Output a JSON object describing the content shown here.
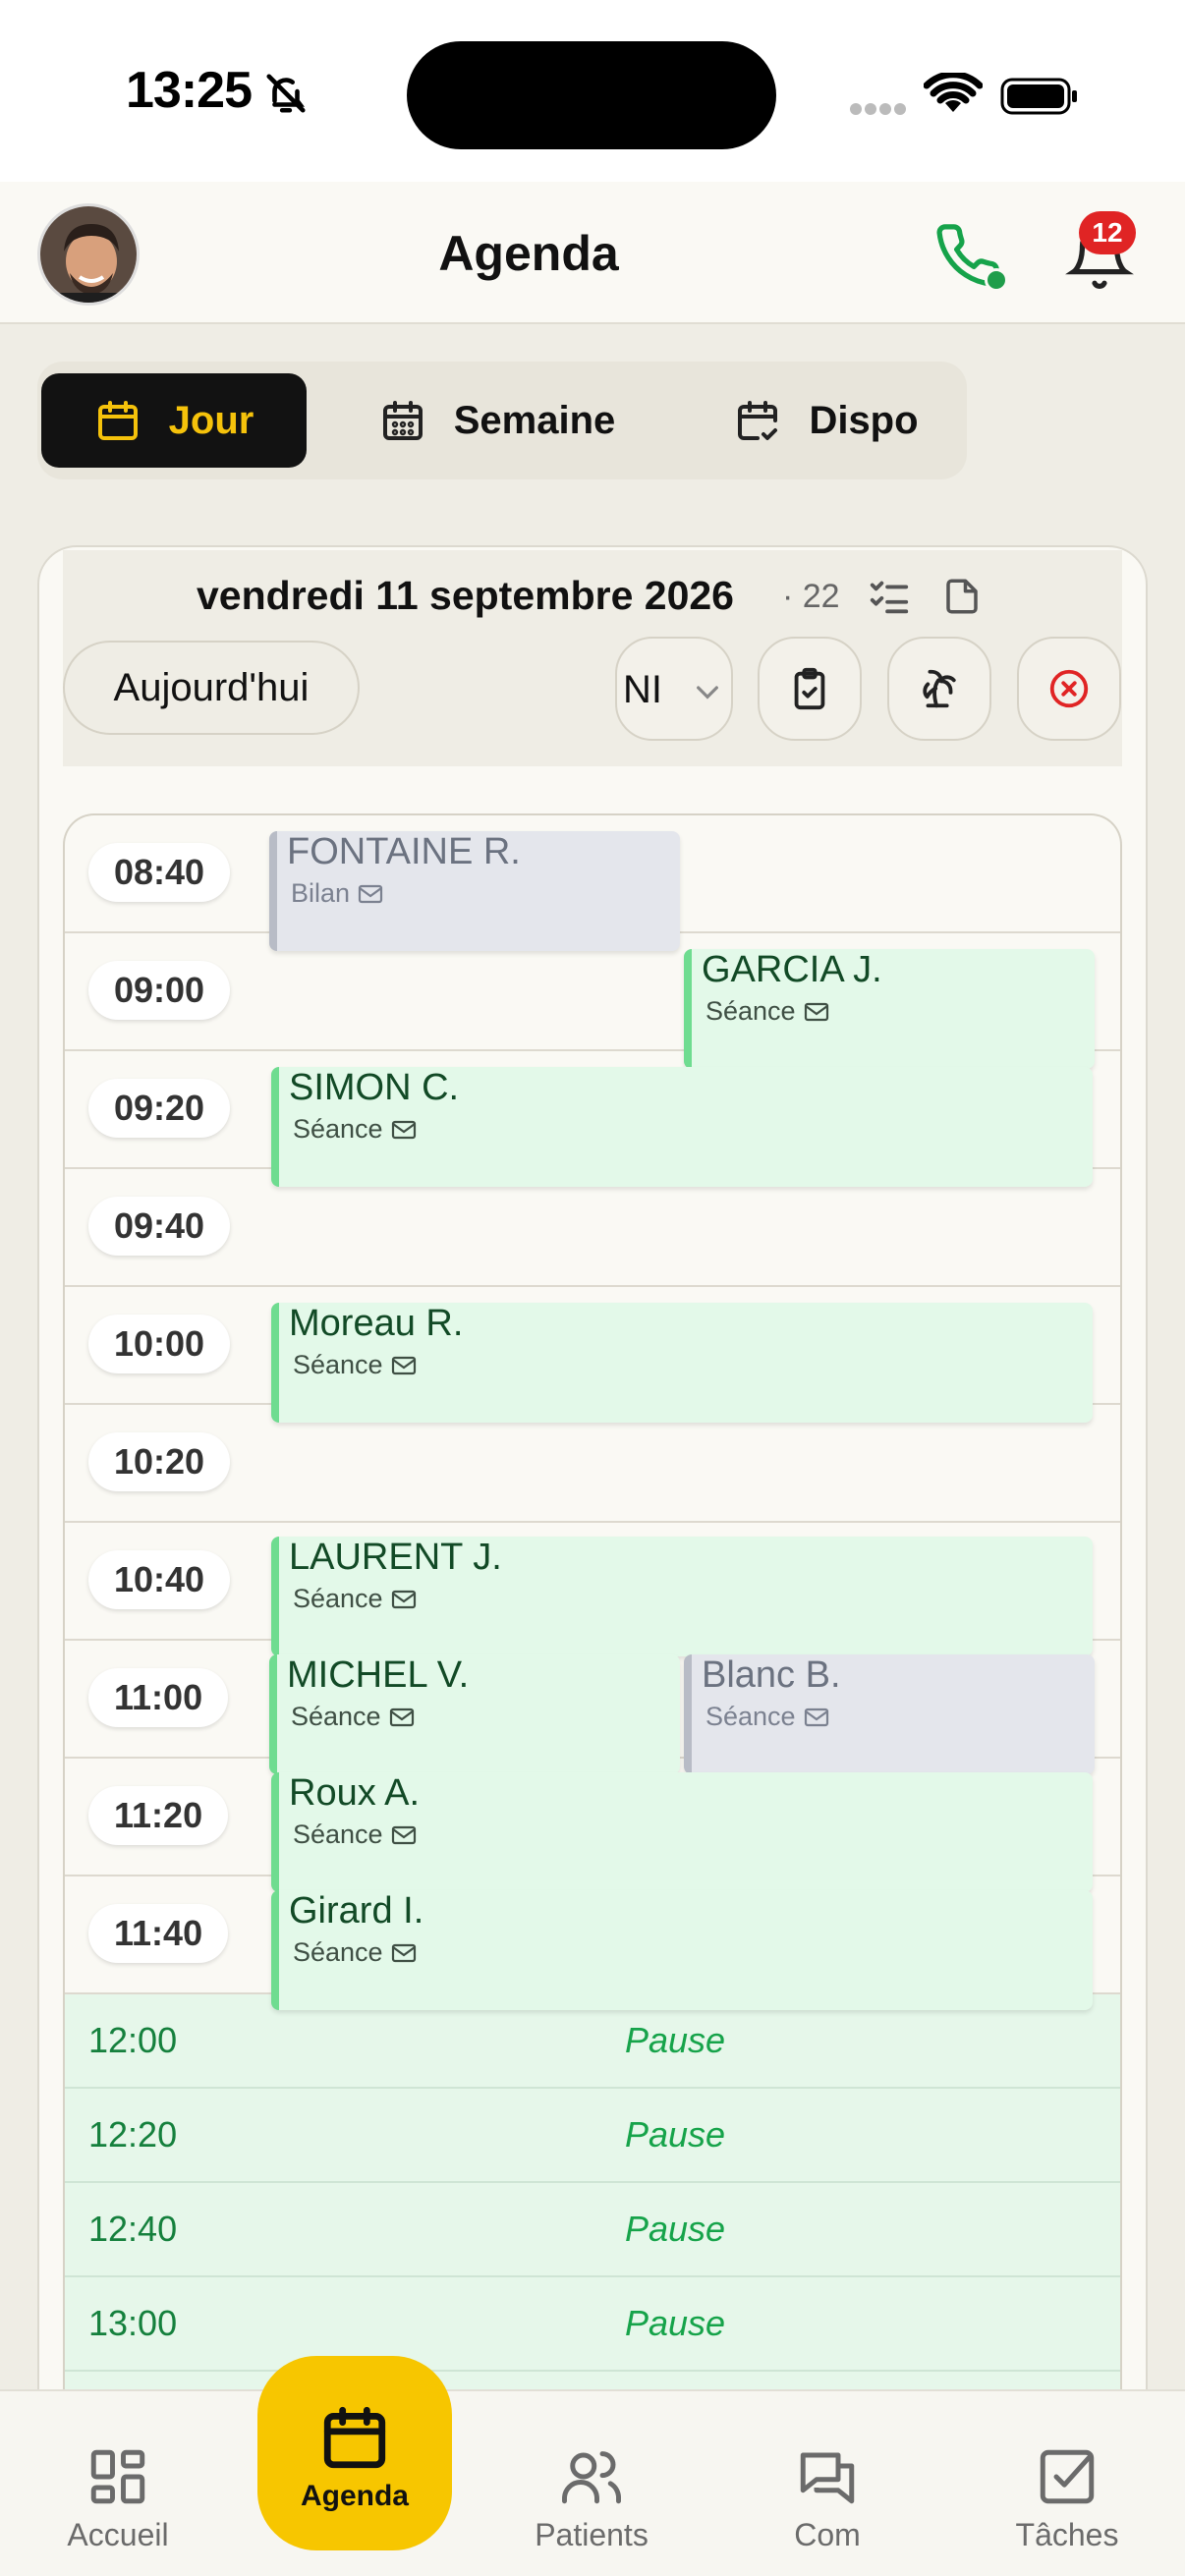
{
  "status_bar": {
    "time": "13:25"
  },
  "header": {
    "title": "Agenda",
    "notification_count": "12"
  },
  "tabs": [
    {
      "label": "Jour",
      "active": true
    },
    {
      "label": "Semaine",
      "active": false
    },
    {
      "label": "Dispo",
      "active": false
    }
  ],
  "date_bar": {
    "date": "vendredi 11 septembre 2026",
    "count": "· 22",
    "today_label": "Aujourd'hui",
    "select_value": "NI"
  },
  "time_slots": [
    "08:40",
    "09:00",
    "09:20",
    "09:40",
    "10:00",
    "10:20",
    "10:40",
    "11:00",
    "11:20",
    "11:40"
  ],
  "appointments": [
    {
      "name": "FONTAINE R.",
      "type": "Bilan",
      "status": "gray"
    },
    {
      "name": "GARCIA J.",
      "type": "Séance",
      "status": "green"
    },
    {
      "name": "SIMON C.",
      "type": "Séance",
      "status": "green"
    },
    {
      "name": "Moreau R.",
      "type": "Séance",
      "status": "green"
    },
    {
      "name": "LAURENT J.",
      "type": "Séance",
      "status": "green"
    },
    {
      "name": "MICHEL V.",
      "type": "Séance",
      "status": "green"
    },
    {
      "name": "Blanc B.",
      "type": "Séance",
      "status": "gray"
    },
    {
      "name": "Roux A.",
      "type": "Séance",
      "status": "green"
    },
    {
      "name": "Girard I.",
      "type": "Séance",
      "status": "green"
    }
  ],
  "pauses": [
    {
      "time": "12:00",
      "label": "Pause"
    },
    {
      "time": "12:20",
      "label": "Pause"
    },
    {
      "time": "12:40",
      "label": "Pause"
    },
    {
      "time": "13:00",
      "label": "Pause"
    }
  ],
  "bottom_nav": [
    {
      "label": "Accueil",
      "icon": "grid-icon"
    },
    {
      "label": "Agenda",
      "icon": "calendar-icon",
      "active": true
    },
    {
      "label": "Patients",
      "icon": "users-icon"
    },
    {
      "label": "Com",
      "icon": "chat-icon"
    },
    {
      "label": "Tâches",
      "icon": "checkbox-icon"
    }
  ],
  "colors": {
    "accent": "#f7c600",
    "active_tab_bg": "#121212",
    "active_tab_text": "#f5c20b",
    "appointment_green": "#e3f9e9",
    "appointment_gray": "#e4e6ec",
    "pause_green": "#16a34a",
    "badge_red": "#e02424"
  }
}
